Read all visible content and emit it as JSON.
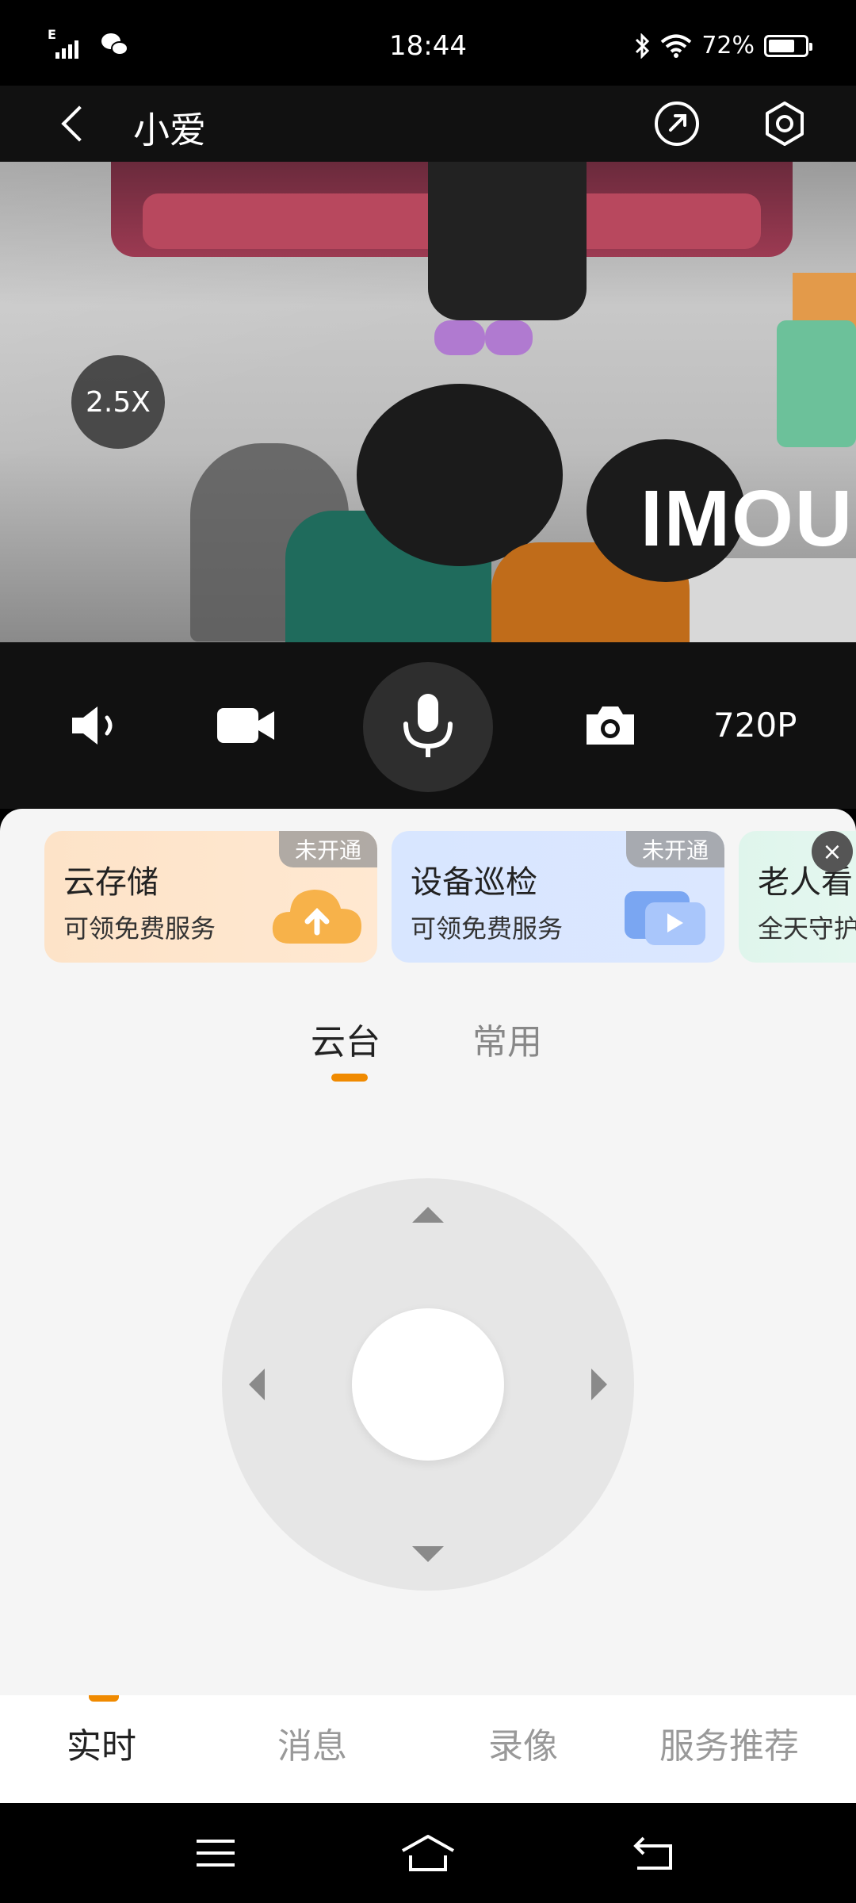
{
  "status_bar": {
    "time": "18:44",
    "battery": "72%",
    "network": "E",
    "battery_level": 0.72
  },
  "header": {
    "back_icon": "chevron-left-icon",
    "title": "小爱",
    "share_icon": "share-icon",
    "settings_icon": "settings-hex-icon"
  },
  "video": {
    "zoom_level": "2.5X",
    "watermark": "IMOU"
  },
  "controls": {
    "speaker_icon": "speaker-icon",
    "record_icon": "video-camera-icon",
    "mic_icon": "microphone-icon",
    "snapshot_icon": "camera-icon",
    "resolution": "720P"
  },
  "service_cards": [
    {
      "title": "云存储",
      "subtitle": "可领免费服务",
      "badge": "未开通",
      "color": "#fde3c8",
      "icon": "cloud-upload-icon"
    },
    {
      "title": "设备巡检",
      "subtitle": "可领免费服务",
      "badge": "未开通",
      "color": "#d8e6ff",
      "icon": "video-chat-icon"
    },
    {
      "title": "老人看",
      "subtitle": "全天守护",
      "badge": "",
      "color": "#dff5ec",
      "icon": ""
    }
  ],
  "close_icon_label": "×",
  "tabs": [
    {
      "label": "云台",
      "active": true
    },
    {
      "label": "常用",
      "active": false
    }
  ],
  "ptz": {
    "up_icon": "arrow-up-icon",
    "down_icon": "arrow-down-icon",
    "left_icon": "arrow-left-icon",
    "right_icon": "arrow-right-icon"
  },
  "bottom_nav": [
    {
      "label": "实时",
      "active": true
    },
    {
      "label": "消息",
      "active": false
    },
    {
      "label": "录像",
      "active": false
    },
    {
      "label": "服务推荐",
      "active": false
    }
  ],
  "system_nav": {
    "menu_icon": "menu-icon",
    "home_icon": "home-icon",
    "back_icon": "back-icon"
  },
  "colors": {
    "accent": "#f08a00",
    "header_bg": "#111111",
    "panel_bg": "#f5f5f5"
  }
}
